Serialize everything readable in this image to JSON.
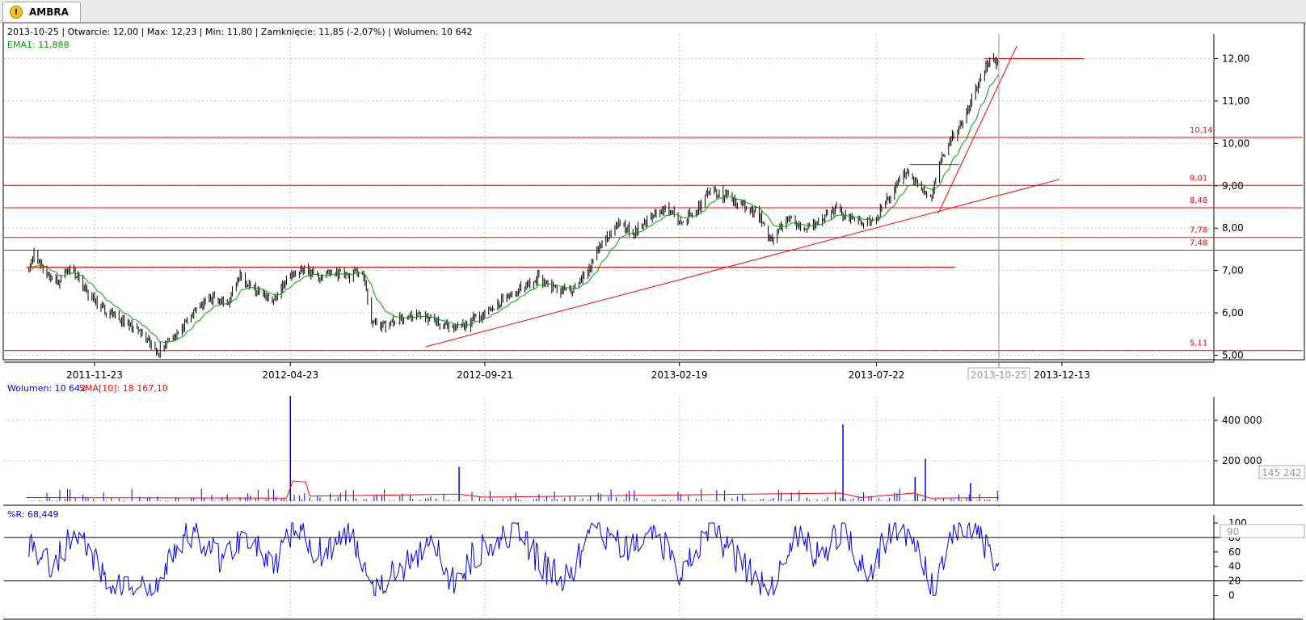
{
  "tab": {
    "title": "AMBRA",
    "icon": "warning-icon"
  },
  "colors": {
    "price": "#000000",
    "ema": "#00a000",
    "level": "#ff0000",
    "trend": "#ff0000",
    "volume": "#0000ff",
    "sma": "#ff0000",
    "wr": "#0000ff"
  },
  "header": {
    "info": "2013-10-25 | Otwarcie: 12,00 | Max: 12,23 | Min: 11,80 | Zamknięcie: 11,85 (-2,07%)  | Wolumen: 10 642",
    "ema": "EMA1: 11,888"
  },
  "volume_header": {
    "volume": "Wolumen: 10 642",
    "sma": "SMA[10]: 18 167,10"
  },
  "wr_header": {
    "label": "%R: 68,449"
  },
  "chart_data": [
    {
      "type": "line",
      "ohlc": true,
      "x_tick_labels": [
        "2011-11-23",
        "2012-04-23",
        "2012-09-21",
        "2013-02-19",
        "2013-07-22",
        "2013-10-25",
        "2013-12-13"
      ],
      "cursor_label": "2013-10-25",
      "y_tick_labels": [
        "5,00",
        "6,00",
        "7,00",
        "8,00",
        "9,00",
        "10,00",
        "11,00",
        "12,00"
      ],
      "ylim": [
        5.0,
        12.5
      ],
      "grid": true,
      "last_bar": {
        "date": "2013-10-25",
        "open": 12.0,
        "high": 12.23,
        "low": 11.8,
        "close": 11.85,
        "change": "-2,07%",
        "volume": 10642
      },
      "ema_last": 11.888,
      "close_series": {
        "name": "",
        "points": [
          [
            "2011-10-01",
            6.9
          ],
          [
            "2011-10-07",
            7.4
          ],
          [
            "2011-10-15",
            7.0
          ],
          [
            "2011-10-25",
            6.7
          ],
          [
            "2011-11-05",
            7.1
          ],
          [
            "2011-11-15",
            6.6
          ],
          [
            "2011-11-25",
            6.2
          ],
          [
            "2011-12-05",
            5.95
          ],
          [
            "2011-12-15",
            5.8
          ],
          [
            "2011-12-28",
            5.55
          ],
          [
            "2012-01-06",
            5.2
          ],
          [
            "2012-01-12",
            5.1
          ],
          [
            "2012-01-20",
            5.4
          ],
          [
            "2012-01-30",
            5.6
          ],
          [
            "2012-02-10",
            6.1
          ],
          [
            "2012-02-22",
            6.35
          ],
          [
            "2012-03-05",
            6.2
          ],
          [
            "2012-03-15",
            6.9
          ],
          [
            "2012-03-28",
            6.5
          ],
          [
            "2012-04-10",
            6.3
          ],
          [
            "2012-04-20",
            6.8
          ],
          [
            "2012-05-02",
            7.05
          ],
          [
            "2012-05-15",
            6.85
          ],
          [
            "2012-05-28",
            6.95
          ],
          [
            "2012-06-08",
            6.9
          ],
          [
            "2012-06-18",
            7.0
          ],
          [
            "2012-06-25",
            5.8
          ],
          [
            "2012-07-05",
            5.7
          ],
          [
            "2012-07-18",
            5.85
          ],
          [
            "2012-08-01",
            5.95
          ],
          [
            "2012-08-15",
            5.8
          ],
          [
            "2012-08-25",
            5.6
          ],
          [
            "2012-09-05",
            5.7
          ],
          [
            "2012-09-20",
            6.0
          ],
          [
            "2012-10-05",
            6.3
          ],
          [
            "2012-10-20",
            6.6
          ],
          [
            "2012-11-01",
            6.85
          ],
          [
            "2012-11-15",
            6.55
          ],
          [
            "2012-11-28",
            6.5
          ],
          [
            "2012-12-10",
            7.0
          ],
          [
            "2012-12-20",
            7.6
          ],
          [
            "2013-01-03",
            8.1
          ],
          [
            "2013-01-15",
            7.9
          ],
          [
            "2013-01-28",
            8.3
          ],
          [
            "2013-02-08",
            8.45
          ],
          [
            "2013-02-20",
            8.2
          ],
          [
            "2013-03-05",
            8.4
          ],
          [
            "2013-03-15",
            8.9
          ],
          [
            "2013-03-28",
            8.75
          ],
          [
            "2013-04-10",
            8.5
          ],
          [
            "2013-04-22",
            8.3
          ],
          [
            "2013-05-02",
            7.7
          ],
          [
            "2013-05-15",
            8.25
          ],
          [
            "2013-05-28",
            7.95
          ],
          [
            "2013-06-08",
            8.2
          ],
          [
            "2013-06-20",
            8.45
          ],
          [
            "2013-07-01",
            8.2
          ],
          [
            "2013-07-12",
            8.1
          ],
          [
            "2013-07-22",
            8.25
          ],
          [
            "2013-08-02",
            8.8
          ],
          [
            "2013-08-12",
            9.3
          ],
          [
            "2013-08-22",
            9.1
          ],
          [
            "2013-09-02",
            8.7
          ],
          [
            "2013-09-10",
            9.6
          ],
          [
            "2013-09-18",
            10.1
          ],
          [
            "2013-09-28",
            10.5
          ],
          [
            "2013-10-05",
            11.1
          ],
          [
            "2013-10-12",
            11.6
          ],
          [
            "2013-10-18",
            12.0
          ],
          [
            "2013-10-25",
            11.85
          ]
        ]
      },
      "horizontal_levels": [
        {
          "label": "10,14",
          "value": 10.14
        },
        {
          "label": "9,01",
          "value": 9.01
        },
        {
          "label": "8,48",
          "value": 8.48
        },
        {
          "label": "7,78",
          "value": 7.78
        },
        {
          "label": "7,48",
          "value": 7.48
        },
        {
          "label": "5,11",
          "value": 5.11
        }
      ],
      "extra_lines": [
        {
          "from": [
            "2011-10-01",
            7.08
          ],
          "to": [
            "2013-09-21",
            7.08
          ]
        },
        {
          "from": [
            "2013-08-17",
            9.5
          ],
          "to": [
            "2013-09-24",
            9.5
          ]
        },
        {
          "from": [
            "2013-10-14",
            12.0
          ],
          "to": [
            "2013-12-30",
            12.0
          ]
        },
        {
          "from": [
            "2012-08-06",
            5.2
          ],
          "to": [
            "2013-12-11",
            9.15
          ]
        },
        {
          "from": [
            "2013-09-08",
            8.35
          ],
          "to": [
            "2013-11-08",
            12.3
          ]
        }
      ]
    },
    {
      "type": "bar",
      "series": [
        {
          "name": "Wolumen",
          "spikes": [
            [
              "2012-04-23",
              520000
            ],
            [
              "2012-09-01",
              170000
            ],
            [
              "2013-06-26",
              380000
            ],
            [
              "2013-08-29",
              210000
            ],
            [
              "2013-08-21",
              120000
            ],
            [
              "2013-10-03",
              90000
            ]
          ]
        },
        {
          "name": "SMA[10]",
          "points": [
            [
              "2011-10-01",
              18000
            ],
            [
              "2012-04-20",
              15000
            ],
            [
              "2012-04-25",
              100000
            ],
            [
              "2012-05-05",
              95000
            ],
            [
              "2012-05-08",
              25000
            ],
            [
              "2012-08-31",
              35000
            ],
            [
              "2012-09-20",
              20000
            ],
            [
              "2013-06-24",
              40000
            ],
            [
              "2013-07-10",
              18000
            ],
            [
              "2013-08-20",
              40000
            ],
            [
              "2013-09-02",
              15000
            ],
            [
              "2013-10-25",
              18167.1
            ]
          ]
        }
      ],
      "y_tick_labels": [
        "200 000",
        "400 000"
      ],
      "cursor_value_label": "145 242",
      "last_volume": 10642,
      "last_sma": 18167.1,
      "ylim": [
        0,
        550000
      ]
    },
    {
      "type": "line",
      "name": "%R",
      "series": [
        {
          "name": "%R",
          "points": [
            [
              "2011-10-01",
              80
            ],
            [
              "2011-10-20",
              40
            ],
            [
              "2011-11-10",
              90
            ],
            [
              "2011-12-01",
              20
            ],
            [
              "2011-12-20",
              10
            ],
            [
              "2012-01-10",
              5
            ],
            [
              "2012-01-25",
              70
            ],
            [
              "2012-02-10",
              85
            ],
            [
              "2012-03-01",
              50
            ],
            [
              "2012-03-20",
              90
            ],
            [
              "2012-04-10",
              30
            ],
            [
              "2012-04-25",
              95
            ],
            [
              "2012-05-15",
              60
            ],
            [
              "2012-06-10",
              85
            ],
            [
              "2012-06-28",
              10
            ],
            [
              "2012-07-20",
              40
            ],
            [
              "2012-08-10",
              80
            ],
            [
              "2012-08-25",
              15
            ],
            [
              "2012-09-20",
              70
            ],
            [
              "2012-10-15",
              90
            ],
            [
              "2012-11-05",
              40
            ],
            [
              "2012-11-25",
              20
            ],
            [
              "2012-12-15",
              95
            ],
            [
              "2013-01-10",
              60
            ],
            [
              "2013-02-01",
              90
            ],
            [
              "2013-02-20",
              30
            ],
            [
              "2013-03-15",
              95
            ],
            [
              "2013-04-10",
              40
            ],
            [
              "2013-05-01",
              5
            ],
            [
              "2013-05-20",
              85
            ],
            [
              "2013-06-10",
              50
            ],
            [
              "2013-06-25",
              95
            ],
            [
              "2013-07-15",
              30
            ],
            [
              "2013-08-05",
              95
            ],
            [
              "2013-08-25",
              60
            ],
            [
              "2013-09-05",
              5
            ],
            [
              "2013-09-20",
              95
            ],
            [
              "2013-10-10",
              90
            ],
            [
              "2013-10-18",
              55
            ],
            [
              "2013-10-25",
              31.5
            ]
          ]
        }
      ],
      "y_tick_labels": [
        "0",
        "20",
        "40",
        "60",
        "80",
        "100"
      ],
      "cursor_value_label": "90",
      "reference_levels": [
        20,
        80
      ],
      "last_value": 68.449,
      "ylim": [
        0,
        100
      ]
    }
  ]
}
